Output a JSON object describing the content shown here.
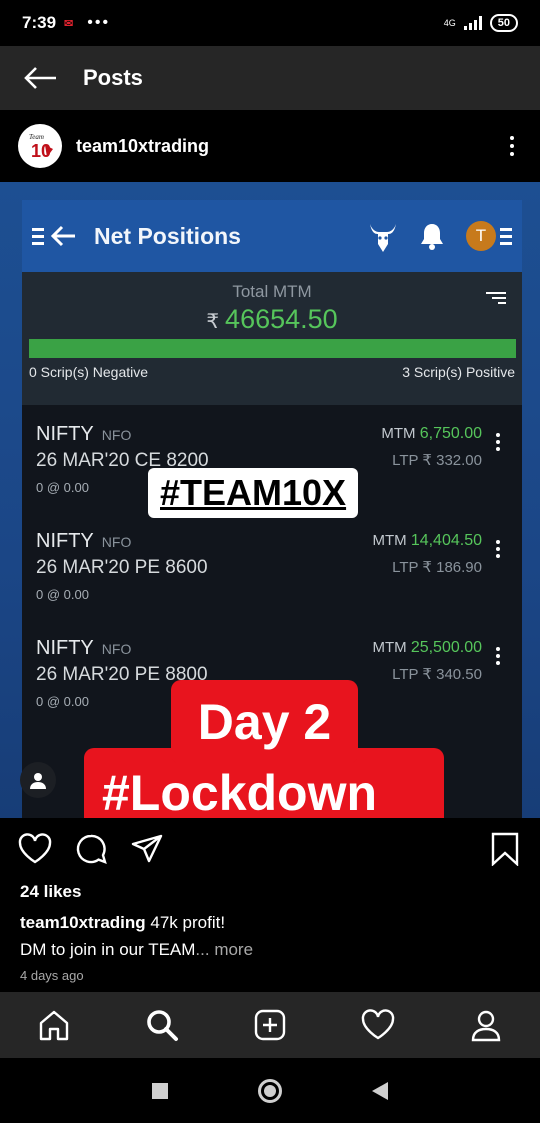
{
  "status_bar": {
    "time": "7:39",
    "network": "4G",
    "battery": "50"
  },
  "header": {
    "title": "Posts"
  },
  "post": {
    "username": "team10xtrading",
    "avatar_text": "TEAM 10X",
    "screenshot": {
      "app_title": "Net Positions",
      "avatar_letter": "T",
      "total_mtm_label": "Total MTM",
      "currency_symbol": "₹",
      "total_mtm_value": "46654.50",
      "negative_text": "0 Scrip(s) Negative",
      "positive_text": "3 Scrip(s) Positive",
      "positions": [
        {
          "symbol": "NIFTY",
          "exchange": "NFO",
          "contract": "26 MAR'20 CE 8200",
          "qty": "0 @ 0.00",
          "mtm_label": "MTM",
          "mtm": "6,750.00",
          "ltp": "LTP ₹ 332.00"
        },
        {
          "symbol": "NIFTY",
          "exchange": "NFO",
          "contract": "26 MAR'20 PE 8600",
          "qty": "0 @ 0.00",
          "mtm_label": "MTM",
          "mtm": "14,404.50",
          "ltp": "LTP ₹ 186.90"
        },
        {
          "symbol": "NIFTY",
          "exchange": "NFO",
          "contract": "26 MAR'20 PE 8800",
          "qty": "0 @ 0.00",
          "mtm_label": "MTM",
          "mtm": "25,500.00",
          "ltp": "LTP ₹ 340.50"
        }
      ],
      "overlay_tag": "#TEAM10X",
      "overlay_day": "Day 2",
      "overlay_lockdown": "#Lockdown"
    },
    "likes": "24 likes",
    "caption_user": "team10xtrading",
    "caption_text": " 47k profit!",
    "caption_line2": "DM to join in our TEAM",
    "caption_more": "... more",
    "time_ago": "4 days ago"
  },
  "colors": {
    "accent_blue": "#1f56a3",
    "profit_green": "#56c55b",
    "overlay_red": "#e8141e"
  }
}
